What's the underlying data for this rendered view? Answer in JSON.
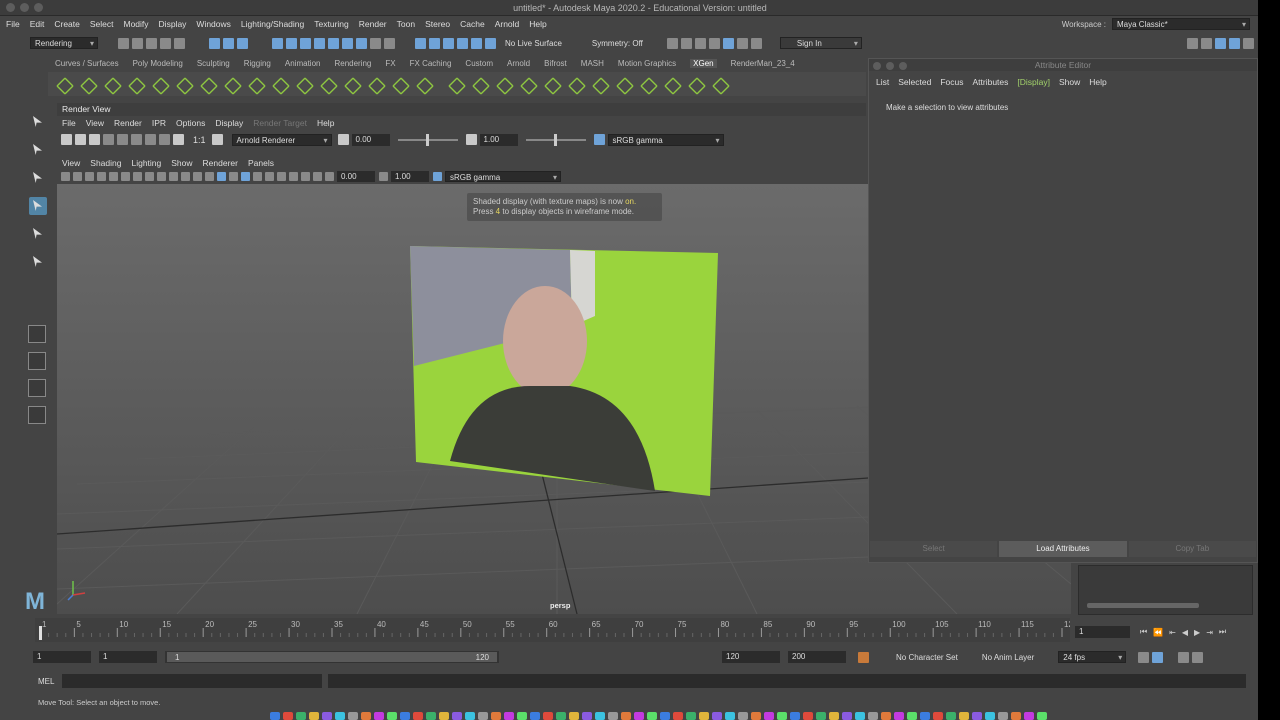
{
  "window": {
    "title": "untitled* - Autodesk Maya 2020.2 - Educational Version: untitled"
  },
  "menubar": [
    "File",
    "Edit",
    "Create",
    "Select",
    "Modify",
    "Display",
    "Windows",
    "Lighting/Shading",
    "Texturing",
    "Render",
    "Toon",
    "Stereo",
    "Cache",
    "Arnold",
    "Help"
  ],
  "workspace": {
    "label": "Workspace :",
    "value": "Maya Classic*"
  },
  "statusline": {
    "menuset": "Rendering",
    "live_surface": "No Live Surface",
    "symmetry": "Symmetry: Off",
    "sign_in": "Sign In"
  },
  "shelf_tabs": [
    "Curves / Surfaces",
    "Poly Modeling",
    "Sculpting",
    "Rigging",
    "Animation",
    "Rendering",
    "FX",
    "FX Caching",
    "Custom",
    "Arnold",
    "Bifrost",
    "MASH",
    "Motion Graphics",
    "XGen",
    "RenderMan_23_4"
  ],
  "shelf_active": "XGen",
  "render_view": {
    "title": "Render View",
    "menu": [
      "File",
      "View",
      "Render",
      "IPR",
      "Options",
      "Display",
      "Render Target",
      "Help"
    ],
    "ratio": "1:1",
    "renderer": "Arnold Renderer",
    "exposure": "0.00",
    "gamma": "1.00",
    "colorspace": "sRGB gamma"
  },
  "viewport": {
    "menu": [
      "View",
      "Shading",
      "Lighting",
      "Show",
      "Renderer",
      "Panels"
    ],
    "exposure": "0.00",
    "gamma": "1.00",
    "colorspace": "sRGB gamma",
    "hud_line1_a": "Shaded display (with texture maps) is now ",
    "hud_line1_b": "on.",
    "hud_line2_a": "Press ",
    "hud_line2_b": "4",
    "hud_line2_c": " to display objects in wireframe mode.",
    "camera": "persp"
  },
  "attribute_editor": {
    "title": "Attribute Editor",
    "menu": [
      "List",
      "Selected",
      "Focus",
      "Attributes",
      "[Display]",
      "Show",
      "Help"
    ],
    "message": "Make a selection to view attributes",
    "buttons": [
      "Select",
      "Load Attributes",
      "Copy Tab"
    ]
  },
  "timeline": {
    "ticks": [
      "1",
      "5",
      "10",
      "15",
      "20",
      "25",
      "30",
      "35",
      "40",
      "45",
      "50",
      "55",
      "60",
      "65",
      "70",
      "75",
      "80",
      "85",
      "90",
      "95",
      "100",
      "105",
      "110",
      "115",
      "120"
    ],
    "current": "1"
  },
  "range": {
    "start": "1",
    "playback_start": "1",
    "range_start": "1",
    "range_end": "120",
    "playback_end": "120",
    "end": "200",
    "character_set": "No Character Set",
    "anim_layer": "No Anim Layer",
    "fps": "24 fps"
  },
  "command": {
    "label": "MEL"
  },
  "help_line": "Move Tool: Select an object to move.",
  "colors": {
    "accent": "#5285a6",
    "shelf_green": "#8ec641",
    "highlight": "#a3d36b"
  }
}
